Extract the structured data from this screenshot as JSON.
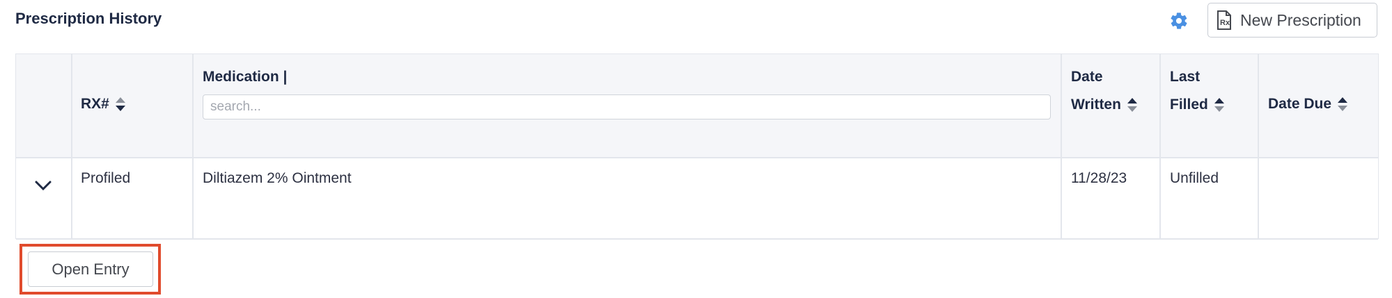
{
  "header": {
    "title": "Prescription History",
    "settings_icon": "gear-icon",
    "new_prescription_label": "New Prescription",
    "new_prescription_icon": "rx-document-icon",
    "accent_color": "#4a90e2"
  },
  "table": {
    "columns": {
      "rx": "RX#",
      "medication": "Medication |",
      "date_written_1": "Date",
      "date_written_2": "Written",
      "last_filled_1": "Last",
      "last_filled_2": "Filled",
      "date_due": "Date Due"
    },
    "search_placeholder": "search...",
    "rows": [
      {
        "rx": "Profiled",
        "medication": "Diltiazem 2% Ointment",
        "date_written": "11/28/23",
        "last_filled": "Unfilled",
        "date_due": ""
      }
    ]
  },
  "footer": {
    "open_entry_label": "Open Entry",
    "highlight_color": "#e04b2d"
  }
}
